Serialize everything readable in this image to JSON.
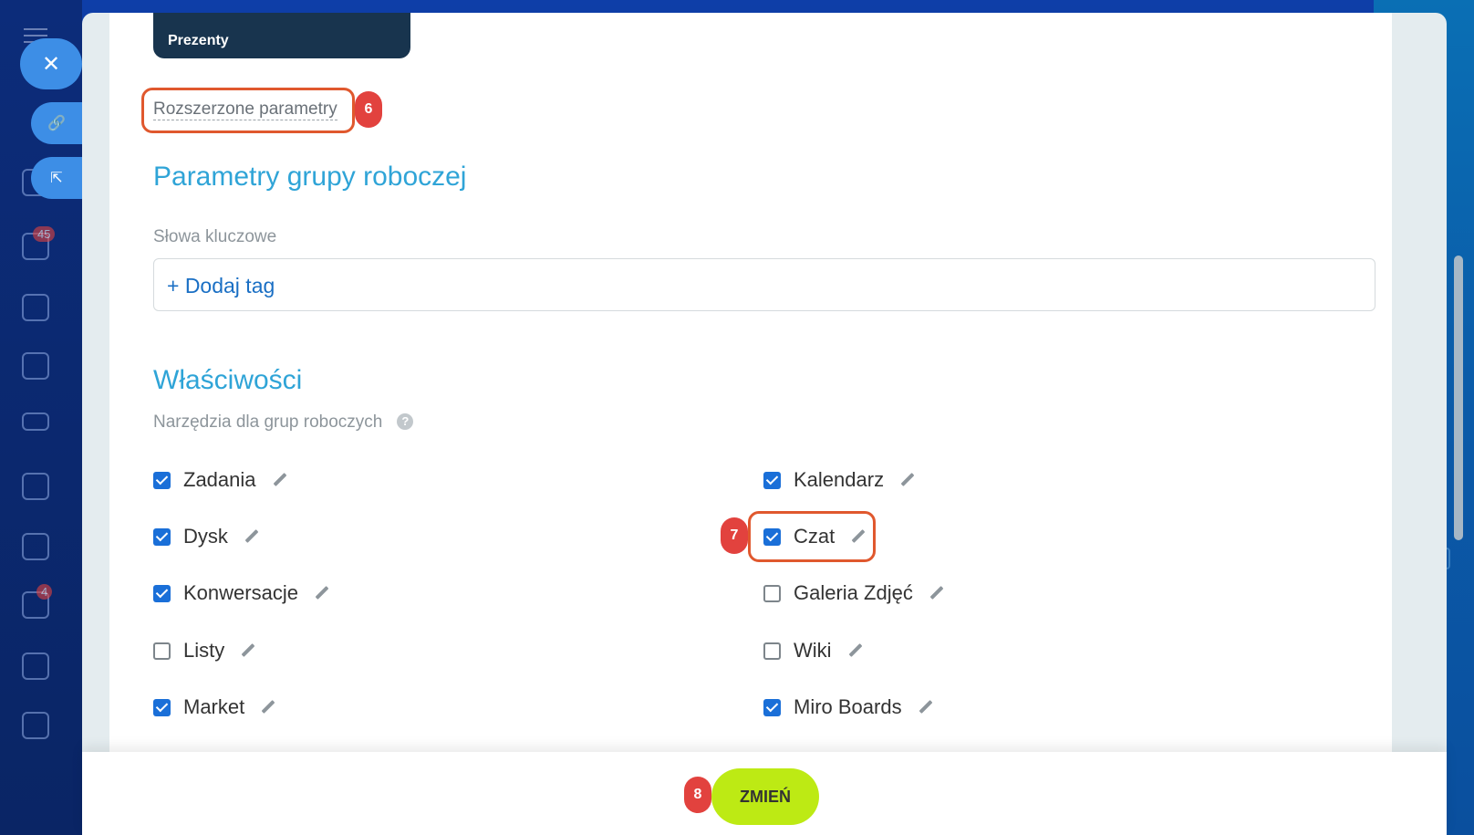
{
  "card": {
    "title": "Prezenty"
  },
  "advanced_link": "Rozszerzone parametry",
  "markers": {
    "step6": "6",
    "step7": "7",
    "step8": "8"
  },
  "workgroup": {
    "heading": "Parametry grupy roboczej",
    "keywords_label": "Słowa kluczowe",
    "add_tag": "+ Dodaj tag"
  },
  "properties": {
    "heading": "Właściwości",
    "tools_label": "Narzędzia dla grup roboczych",
    "help_icon": "?",
    "left": [
      {
        "label": "Zadania",
        "checked": true
      },
      {
        "label": "Dysk",
        "checked": true
      },
      {
        "label": "Konwersacje",
        "checked": true
      },
      {
        "label": "Listy",
        "checked": false
      },
      {
        "label": "Market",
        "checked": true
      }
    ],
    "right": [
      {
        "label": "Kalendarz",
        "checked": true
      },
      {
        "label": "Czat",
        "checked": true
      },
      {
        "label": "Galeria Zdjęć",
        "checked": false
      },
      {
        "label": "Wiki",
        "checked": false
      },
      {
        "label": "Miro Boards",
        "checked": true
      }
    ]
  },
  "sidebar": {
    "badge_tasks": "45",
    "badge_mail": "4"
  },
  "footer": {
    "submit": "ZMIEŃ"
  },
  "colors": {
    "accent_blue": "#2fa4d7",
    "checkbox": "#1a6fd8",
    "highlight": "#e0582e",
    "marker": "#e2423e",
    "submit_bg": "#bdea14"
  }
}
